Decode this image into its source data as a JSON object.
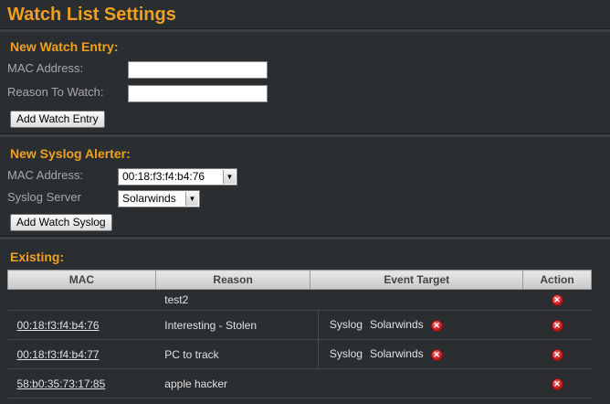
{
  "page": {
    "title": "Watch List Settings"
  },
  "watch_entry": {
    "title": "New Watch Entry:",
    "mac_label": "MAC Address:",
    "reason_label": "Reason To Watch:",
    "mac_value": "",
    "reason_value": "",
    "button": "Add Watch Entry"
  },
  "syslog": {
    "title": "New Syslog Alerter:",
    "mac_label": "MAC Address:",
    "mac_selected": "00:18:f3:f4:b4:76",
    "server_label": "Syslog Server",
    "server_selected": "Solarwinds",
    "button": "Add Watch Syslog"
  },
  "existing": {
    "title": "Existing:",
    "columns": [
      "MAC",
      "Reason",
      "Event Target",
      "Action"
    ],
    "rows": [
      {
        "mac": "",
        "reason": "test2",
        "target_type": "",
        "target_server": ""
      },
      {
        "mac": "00:18:f3:f4:b4:76",
        "reason": "Interesting - Stolen",
        "target_type": "Syslog",
        "target_server": "Solarwinds"
      },
      {
        "mac": "00:18:f3:f4:b4:77",
        "reason": "PC to track",
        "target_type": "Syslog",
        "target_server": "Solarwinds"
      },
      {
        "mac": "58:b0:35:73:17:85",
        "reason": "apple hacker",
        "target_type": "",
        "target_server": ""
      }
    ]
  },
  "icons": {
    "delete": "delete-icon",
    "dropdown": "chevron-down-icon"
  },
  "colors": {
    "accent": "#f0a020",
    "background": "#2b2e31",
    "delete": "#c01818"
  }
}
